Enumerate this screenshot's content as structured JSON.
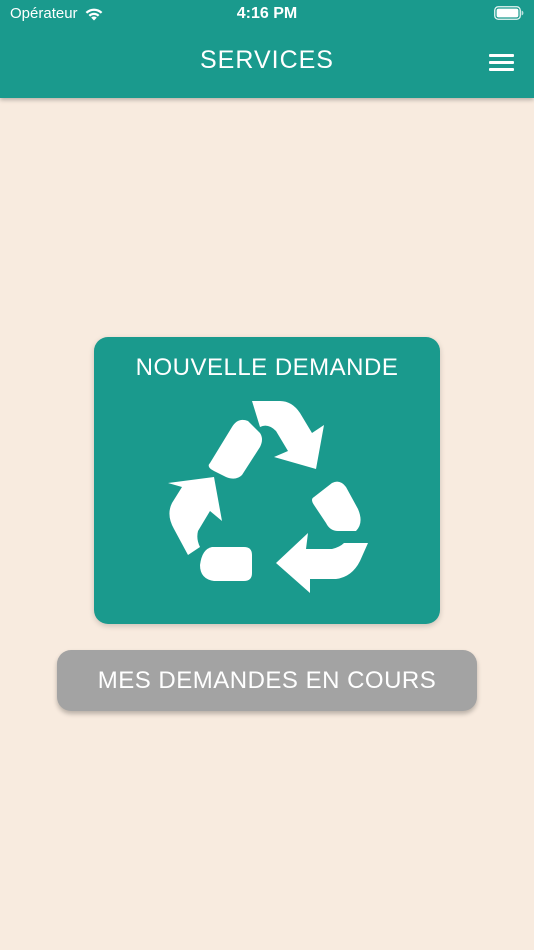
{
  "status_bar": {
    "carrier": "Opérateur",
    "time": "4:16 PM"
  },
  "header": {
    "title": "SERVICES"
  },
  "main": {
    "new_request_label": "NOUVELLE DEMANDE",
    "my_requests_label": "MES DEMANDES EN COURS"
  },
  "colors": {
    "primary": "#1a9a8d",
    "background": "#f8ebdf",
    "secondary_button": "#a3a3a3"
  },
  "icons": [
    "wifi-icon",
    "battery-icon",
    "hamburger-menu-icon",
    "recycle-icon"
  ]
}
